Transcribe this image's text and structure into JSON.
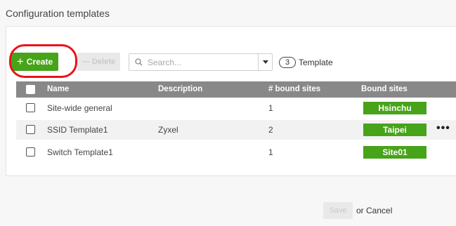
{
  "page": {
    "title": "Configuration templates"
  },
  "toolbar": {
    "create_label": "Create",
    "delete_label": "Delete",
    "search_placeholder": "Search...",
    "count": "3",
    "count_label": "Template"
  },
  "table": {
    "headers": {
      "name": "Name",
      "description": "Description",
      "bound_count": "# bound sites",
      "bound_sites": "Bound sites"
    },
    "rows": [
      {
        "name": "Site-wide general",
        "description": "",
        "bound_count": "1",
        "site": "Hsinchu"
      },
      {
        "name": "SSID Template1",
        "description": "Zyxel",
        "bound_count": "2",
        "site": "Taipei"
      },
      {
        "name": "Switch Template1",
        "description": "",
        "bound_count": "1",
        "site": "Site01"
      }
    ]
  },
  "footer": {
    "save_label": "Save",
    "cancel_text": "or Cancel"
  },
  "colors": {
    "accent": "#47a31a",
    "highlight": "#e8141b",
    "header_bg": "#888888"
  }
}
